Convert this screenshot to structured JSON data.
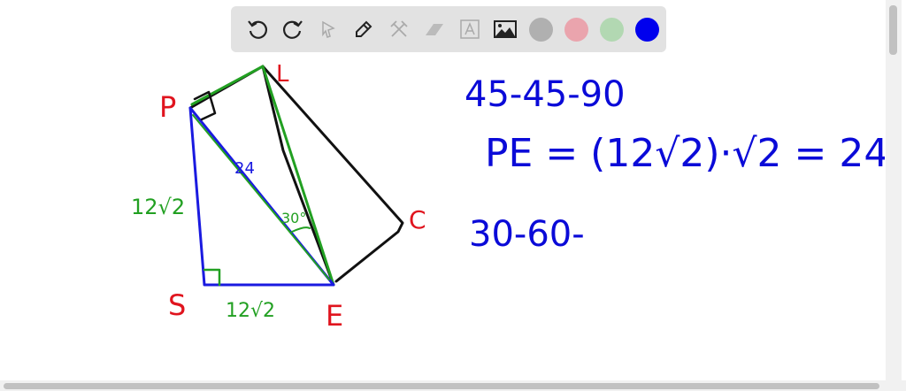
{
  "toolbar": {
    "tools": [
      "undo",
      "redo",
      "select",
      "pen",
      "tools",
      "eraser",
      "text",
      "image"
    ],
    "colors": {
      "gray": "#b0b0b0",
      "pink": "#eaa4ad",
      "green": "#b2d8b2",
      "blue": "#0000ee"
    }
  },
  "drawing": {
    "labels": {
      "P": "P",
      "L": "L",
      "C": "C",
      "S": "S",
      "E": "E"
    },
    "pe_length": "24",
    "ps_length": "12√2",
    "se_length": "12√2",
    "angle": "30°"
  },
  "notes": {
    "line1": "45-45-90",
    "line2": "PE = (12√2)·√2 = 24",
    "line3": "30-60-"
  }
}
